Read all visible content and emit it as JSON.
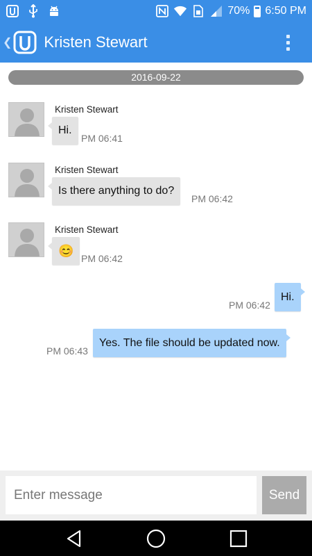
{
  "status_bar": {
    "battery_percent": "70%",
    "time": "6:50 PM",
    "icons": [
      "app-notification-icon",
      "usb-icon",
      "android-debug-icon",
      "nfc-icon",
      "wifi-icon",
      "sim-icon",
      "signal-icon",
      "battery-icon"
    ]
  },
  "header": {
    "title": "Kristen Stewart",
    "back_icon": "back-chevron-icon",
    "logo_icon": "app-logo-icon",
    "menu_icon": "overflow-menu-icon"
  },
  "conversation": {
    "date": "2016-09-22",
    "messages": [
      {
        "direction": "incoming",
        "sender": "Kristen Stewart",
        "text": "Hi.",
        "time": "PM 06:41"
      },
      {
        "direction": "incoming",
        "sender": "Kristen Stewart",
        "text": "Is there anything to do?",
        "time": "PM 06:42"
      },
      {
        "direction": "incoming",
        "sender": "Kristen Stewart",
        "text": "😊",
        "time": "PM 06:42"
      },
      {
        "direction": "outgoing",
        "text": "Hi.",
        "time": "PM 06:42"
      },
      {
        "direction": "outgoing",
        "text": "Yes. The file should be updated now.",
        "time": "PM 06:43"
      }
    ]
  },
  "composer": {
    "placeholder": "Enter message",
    "value": "",
    "send_label": "Send"
  },
  "nav_bar": {
    "icons": [
      "back-triangle-icon",
      "home-circle-icon",
      "recents-square-icon"
    ]
  },
  "colors": {
    "accent": "#3a8ee6",
    "incoming_bubble": "#e3e3e3",
    "outgoing_bubble": "#a9d3fb",
    "send_button": "#ababab",
    "date_pill": "#8b8b8b"
  }
}
